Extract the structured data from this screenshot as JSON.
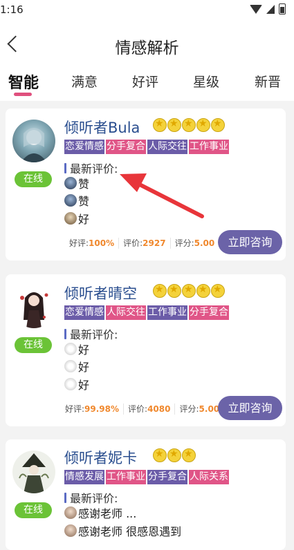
{
  "status_bar": {
    "time": "1:16"
  },
  "header": {
    "title": "情感解析"
  },
  "tabs": [
    "智能",
    "满意",
    "好评",
    "星级",
    "新晋"
  ],
  "labels": {
    "online": "在线",
    "latest_reviews": "最新评价:",
    "praise": "好评:",
    "reviews": "评价:",
    "score": "评分:",
    "consult": "立即咨询"
  },
  "listeners": [
    {
      "name": "倾听者Bula",
      "stars": 5,
      "tags": [
        "恋爱情感",
        "分手复合",
        "人际交往",
        "工作事业"
      ],
      "reviews": [
        "赞",
        "赞",
        "好"
      ],
      "praise_rate": "100%",
      "review_count": "2927",
      "score": "5.00"
    },
    {
      "name": "倾听者晴空",
      "stars": 5,
      "tags": [
        "恋爱情感",
        "人际交往",
        "工作事业",
        "分手复合"
      ],
      "reviews": [
        "好",
        "好",
        "好"
      ],
      "praise_rate": "99.98%",
      "review_count": "4080",
      "score": "5.00"
    },
    {
      "name": "倾听者妮卡",
      "stars": 3,
      "tags": [
        "情感发展",
        "工作事业",
        "分手复合",
        "人际关系"
      ],
      "reviews": [
        "感谢老师 ...",
        "感谢老师  很感恩遇到"
      ]
    }
  ],
  "colors": {
    "tag_pink": "#e05587",
    "tag_purple": "#6b5ca8",
    "online_green": "#6bc337",
    "button_purple": "#6b63a8",
    "name_blue": "#2a4e8f",
    "stat_orange": "#f0882d",
    "arrow_red": "#e8353a"
  }
}
